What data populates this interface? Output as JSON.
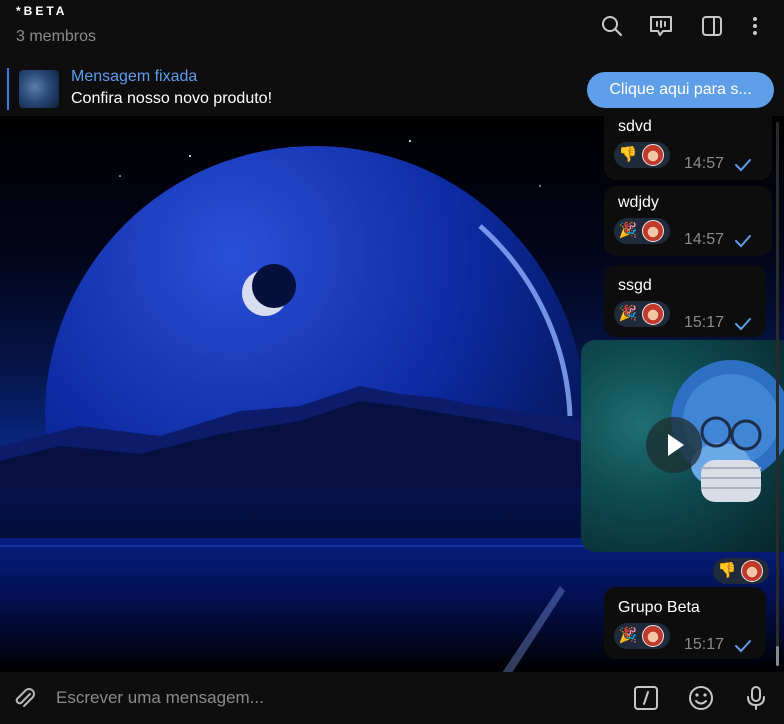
{
  "header": {
    "title": "*BETA",
    "subtitle": "3 membros",
    "icons": [
      "search-icon",
      "live-chat-icon",
      "sidebar-toggle-icon",
      "more-vertical-icon"
    ]
  },
  "pinned": {
    "title": "Mensagem fixada",
    "text": "Confira nosso novo produto!",
    "button_label": "Clique aqui para s..."
  },
  "messages": [
    {
      "text": "sdvd",
      "reactions": [
        "👎",
        "avatar"
      ],
      "time": "14:57",
      "status": "sent"
    },
    {
      "text": "wdjdy",
      "reactions": [
        "🎉",
        "avatar"
      ],
      "time": "14:57",
      "status": "sent"
    },
    {
      "text": "ssgd",
      "reactions": [
        "🎉",
        "avatar"
      ],
      "time": "15:17",
      "status": "sent"
    },
    {
      "type": "video",
      "reactions": [
        "👎",
        "avatar"
      ]
    },
    {
      "text": "Grupo Beta",
      "reactions": [
        "🎉",
        "avatar"
      ],
      "time": "15:17",
      "status": "sent"
    }
  ],
  "composer": {
    "placeholder": "Escrever uma mensagem...",
    "icons": [
      "attach-icon",
      "commands-icon",
      "emoji-icon",
      "microphone-icon"
    ]
  },
  "colors": {
    "accent": "#5f9ee8",
    "pinned_title": "#5c9ded",
    "check": "#5c9ded",
    "bubble": "#0d0d0d"
  }
}
